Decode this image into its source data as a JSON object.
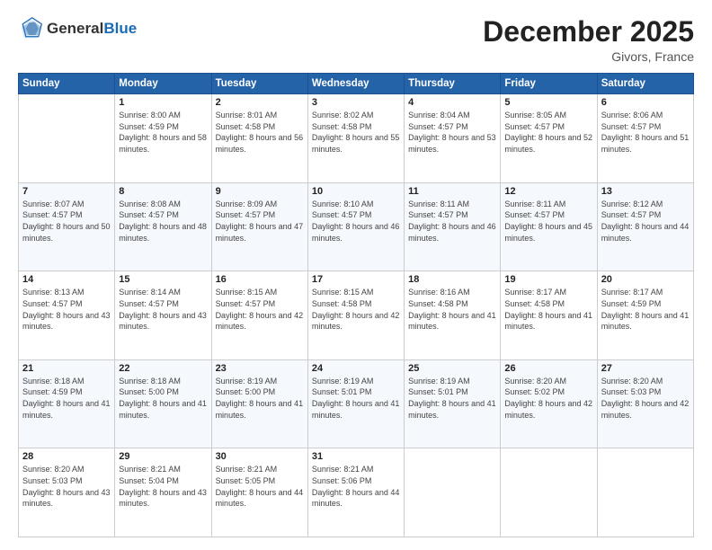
{
  "header": {
    "logo_general": "General",
    "logo_blue": "Blue",
    "month_title": "December 2025",
    "location": "Givors, France"
  },
  "days_of_week": [
    "Sunday",
    "Monday",
    "Tuesday",
    "Wednesday",
    "Thursday",
    "Friday",
    "Saturday"
  ],
  "weeks": [
    [
      {
        "day": "",
        "sunrise": "",
        "sunset": "",
        "daylight": ""
      },
      {
        "day": "1",
        "sunrise": "Sunrise: 8:00 AM",
        "sunset": "Sunset: 4:59 PM",
        "daylight": "Daylight: 8 hours and 58 minutes."
      },
      {
        "day": "2",
        "sunrise": "Sunrise: 8:01 AM",
        "sunset": "Sunset: 4:58 PM",
        "daylight": "Daylight: 8 hours and 56 minutes."
      },
      {
        "day": "3",
        "sunrise": "Sunrise: 8:02 AM",
        "sunset": "Sunset: 4:58 PM",
        "daylight": "Daylight: 8 hours and 55 minutes."
      },
      {
        "day": "4",
        "sunrise": "Sunrise: 8:04 AM",
        "sunset": "Sunset: 4:57 PM",
        "daylight": "Daylight: 8 hours and 53 minutes."
      },
      {
        "day": "5",
        "sunrise": "Sunrise: 8:05 AM",
        "sunset": "Sunset: 4:57 PM",
        "daylight": "Daylight: 8 hours and 52 minutes."
      },
      {
        "day": "6",
        "sunrise": "Sunrise: 8:06 AM",
        "sunset": "Sunset: 4:57 PM",
        "daylight": "Daylight: 8 hours and 51 minutes."
      }
    ],
    [
      {
        "day": "7",
        "sunrise": "Sunrise: 8:07 AM",
        "sunset": "Sunset: 4:57 PM",
        "daylight": "Daylight: 8 hours and 50 minutes."
      },
      {
        "day": "8",
        "sunrise": "Sunrise: 8:08 AM",
        "sunset": "Sunset: 4:57 PM",
        "daylight": "Daylight: 8 hours and 48 minutes."
      },
      {
        "day": "9",
        "sunrise": "Sunrise: 8:09 AM",
        "sunset": "Sunset: 4:57 PM",
        "daylight": "Daylight: 8 hours and 47 minutes."
      },
      {
        "day": "10",
        "sunrise": "Sunrise: 8:10 AM",
        "sunset": "Sunset: 4:57 PM",
        "daylight": "Daylight: 8 hours and 46 minutes."
      },
      {
        "day": "11",
        "sunrise": "Sunrise: 8:11 AM",
        "sunset": "Sunset: 4:57 PM",
        "daylight": "Daylight: 8 hours and 46 minutes."
      },
      {
        "day": "12",
        "sunrise": "Sunrise: 8:11 AM",
        "sunset": "Sunset: 4:57 PM",
        "daylight": "Daylight: 8 hours and 45 minutes."
      },
      {
        "day": "13",
        "sunrise": "Sunrise: 8:12 AM",
        "sunset": "Sunset: 4:57 PM",
        "daylight": "Daylight: 8 hours and 44 minutes."
      }
    ],
    [
      {
        "day": "14",
        "sunrise": "Sunrise: 8:13 AM",
        "sunset": "Sunset: 4:57 PM",
        "daylight": "Daylight: 8 hours and 43 minutes."
      },
      {
        "day": "15",
        "sunrise": "Sunrise: 8:14 AM",
        "sunset": "Sunset: 4:57 PM",
        "daylight": "Daylight: 8 hours and 43 minutes."
      },
      {
        "day": "16",
        "sunrise": "Sunrise: 8:15 AM",
        "sunset": "Sunset: 4:57 PM",
        "daylight": "Daylight: 8 hours and 42 minutes."
      },
      {
        "day": "17",
        "sunrise": "Sunrise: 8:15 AM",
        "sunset": "Sunset: 4:58 PM",
        "daylight": "Daylight: 8 hours and 42 minutes."
      },
      {
        "day": "18",
        "sunrise": "Sunrise: 8:16 AM",
        "sunset": "Sunset: 4:58 PM",
        "daylight": "Daylight: 8 hours and 41 minutes."
      },
      {
        "day": "19",
        "sunrise": "Sunrise: 8:17 AM",
        "sunset": "Sunset: 4:58 PM",
        "daylight": "Daylight: 8 hours and 41 minutes."
      },
      {
        "day": "20",
        "sunrise": "Sunrise: 8:17 AM",
        "sunset": "Sunset: 4:59 PM",
        "daylight": "Daylight: 8 hours and 41 minutes."
      }
    ],
    [
      {
        "day": "21",
        "sunrise": "Sunrise: 8:18 AM",
        "sunset": "Sunset: 4:59 PM",
        "daylight": "Daylight: 8 hours and 41 minutes."
      },
      {
        "day": "22",
        "sunrise": "Sunrise: 8:18 AM",
        "sunset": "Sunset: 5:00 PM",
        "daylight": "Daylight: 8 hours and 41 minutes."
      },
      {
        "day": "23",
        "sunrise": "Sunrise: 8:19 AM",
        "sunset": "Sunset: 5:00 PM",
        "daylight": "Daylight: 8 hours and 41 minutes."
      },
      {
        "day": "24",
        "sunrise": "Sunrise: 8:19 AM",
        "sunset": "Sunset: 5:01 PM",
        "daylight": "Daylight: 8 hours and 41 minutes."
      },
      {
        "day": "25",
        "sunrise": "Sunrise: 8:19 AM",
        "sunset": "Sunset: 5:01 PM",
        "daylight": "Daylight: 8 hours and 41 minutes."
      },
      {
        "day": "26",
        "sunrise": "Sunrise: 8:20 AM",
        "sunset": "Sunset: 5:02 PM",
        "daylight": "Daylight: 8 hours and 42 minutes."
      },
      {
        "day": "27",
        "sunrise": "Sunrise: 8:20 AM",
        "sunset": "Sunset: 5:03 PM",
        "daylight": "Daylight: 8 hours and 42 minutes."
      }
    ],
    [
      {
        "day": "28",
        "sunrise": "Sunrise: 8:20 AM",
        "sunset": "Sunset: 5:03 PM",
        "daylight": "Daylight: 8 hours and 43 minutes."
      },
      {
        "day": "29",
        "sunrise": "Sunrise: 8:21 AM",
        "sunset": "Sunset: 5:04 PM",
        "daylight": "Daylight: 8 hours and 43 minutes."
      },
      {
        "day": "30",
        "sunrise": "Sunrise: 8:21 AM",
        "sunset": "Sunset: 5:05 PM",
        "daylight": "Daylight: 8 hours and 44 minutes."
      },
      {
        "day": "31",
        "sunrise": "Sunrise: 8:21 AM",
        "sunset": "Sunset: 5:06 PM",
        "daylight": "Daylight: 8 hours and 44 minutes."
      },
      {
        "day": "",
        "sunrise": "",
        "sunset": "",
        "daylight": ""
      },
      {
        "day": "",
        "sunrise": "",
        "sunset": "",
        "daylight": ""
      },
      {
        "day": "",
        "sunrise": "",
        "sunset": "",
        "daylight": ""
      }
    ]
  ]
}
